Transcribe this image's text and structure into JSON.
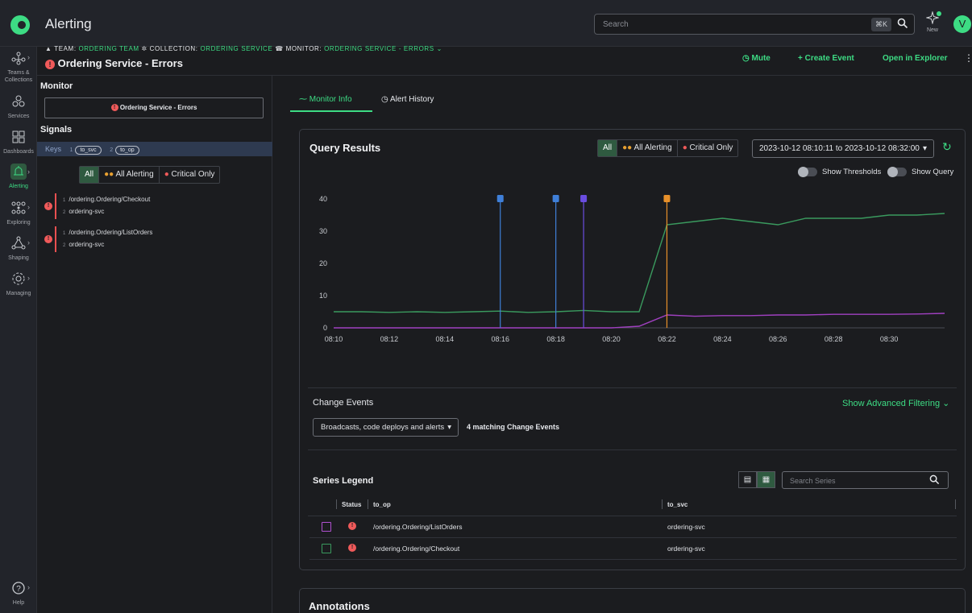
{
  "app": {
    "title": "Alerting",
    "avatar_letter": "V",
    "new_label": "New"
  },
  "search": {
    "placeholder": "Search",
    "shortcut": "⌘K"
  },
  "nav": {
    "items": [
      {
        "label": "Teams & Collections",
        "icon": "teams-icon"
      },
      {
        "label": "Services",
        "icon": "services-icon"
      },
      {
        "label": "Dashboards",
        "icon": "dashboards-icon"
      },
      {
        "label": "Alerting",
        "icon": "alerting-icon",
        "active": true
      },
      {
        "label": "Exploring",
        "icon": "exploring-icon"
      },
      {
        "label": "Shaping",
        "icon": "shaping-icon"
      },
      {
        "label": "Managing",
        "icon": "managing-icon"
      }
    ],
    "help_label": "Help"
  },
  "breadcrumb": {
    "team_key": "TEAM:",
    "team_value": "ORDERING TEAM",
    "collection_key": "COLLECTION:",
    "collection_value": "ORDERING SERVICE",
    "monitor_key": "MONITOR:",
    "monitor_value": "ORDERING SERVICE - ERRORS"
  },
  "monitor_title": "Ordering Service - Errors",
  "actions": {
    "mute": "Mute",
    "create_event": "Create Event",
    "open_explorer": "Open in Explorer"
  },
  "left_panel": {
    "monitor_heading": "Monitor",
    "monitor_name": "Ordering Service - Errors",
    "signals_heading": "Signals",
    "keys_label": "Keys",
    "keys": [
      {
        "n": "1",
        "name": "to_svc"
      },
      {
        "n": "2",
        "name": "to_op"
      }
    ],
    "filters": [
      "All",
      "All Alerting",
      "Critical Only"
    ],
    "signals": [
      {
        "n1": "1",
        "line1": "/ordering.Ordering/Checkout",
        "n2": "2",
        "line2": "ordering-svc"
      },
      {
        "n1": "1",
        "line1": "/ordering.Ordering/ListOrders",
        "n2": "2",
        "line2": "ordering-svc"
      }
    ]
  },
  "tabs": [
    {
      "label": "Monitor Info",
      "active": true
    },
    {
      "label": "Alert History"
    }
  ],
  "query_results": {
    "title": "Query Results",
    "filters": [
      "All",
      "All Alerting",
      "Critical Only"
    ],
    "time_range": "2023-10-12 08:10:11 to 2023-10-12 08:32:00",
    "show_thresholds": "Show Thresholds",
    "show_query": "Show Query"
  },
  "chart_data": {
    "type": "line",
    "x": [
      "08:10",
      "08:11",
      "08:12",
      "08:13",
      "08:14",
      "08:15",
      "08:16",
      "08:17",
      "08:18",
      "08:19",
      "08:20",
      "08:21",
      "08:22",
      "08:23",
      "08:24",
      "08:25",
      "08:26",
      "08:27",
      "08:28",
      "08:29",
      "08:30",
      "08:31",
      "08:32"
    ],
    "x_ticks": [
      "08:10",
      "08:12",
      "08:14",
      "08:16",
      "08:18",
      "08:20",
      "08:22",
      "08:24",
      "08:26",
      "08:28",
      "08:30"
    ],
    "y_ticks": [
      "0",
      "10",
      "20",
      "30",
      "40"
    ],
    "ylim": [
      0,
      40
    ],
    "series": [
      {
        "color": "#3a9a5e",
        "values": [
          5,
          5,
          4.8,
          5,
          4.8,
          5,
          5.2,
          4.8,
          5,
          5.4,
          5,
          5,
          32,
          33,
          34,
          33,
          32,
          34,
          34,
          34,
          35,
          35,
          35.5
        ]
      },
      {
        "color": "#a040c0",
        "values": [
          0,
          0,
          0,
          0,
          0,
          0,
          0,
          0,
          0,
          0,
          0,
          0.5,
          4,
          3.6,
          3.8,
          3.8,
          4,
          4,
          4.2,
          4.2,
          4.2,
          4.3,
          4.5
        ]
      }
    ],
    "markers": [
      {
        "x": "08:16",
        "color": "#3f7fd8"
      },
      {
        "x": "08:18",
        "color": "#3f7fd8"
      },
      {
        "x": "08:19",
        "color": "#6a4de0"
      },
      {
        "x": "08:22",
        "color": "#e8902a"
      }
    ]
  },
  "change_events": {
    "label": "Change Events",
    "advanced": "Show Advanced Filtering",
    "dropdown": "Broadcasts, code deploys and alerts",
    "matching": "4 matching Change Events"
  },
  "series_legend": {
    "title": "Series Legend",
    "search_placeholder": "Search Series",
    "columns": [
      "Status",
      "to_op",
      "to_svc"
    ],
    "rows": [
      {
        "color": "#b050d0",
        "op": "/ordering.Ordering/ListOrders",
        "svc": "ordering-svc"
      },
      {
        "color": "#3a9a5e",
        "op": "/ordering.Ordering/Checkout",
        "svc": "ordering-svc"
      }
    ]
  },
  "annotations": {
    "title": "Annotations"
  }
}
